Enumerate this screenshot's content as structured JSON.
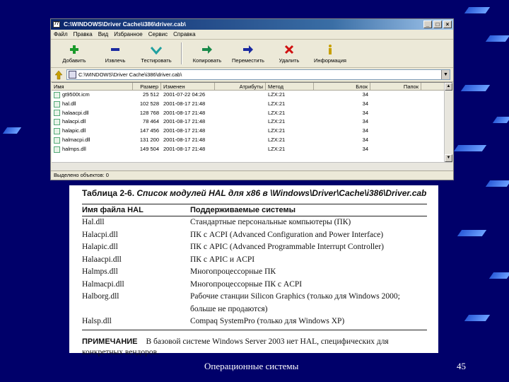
{
  "window": {
    "title": "C:\\WINDOWS\\Driver Cache\\i386\\driver.cab\\",
    "app_icon": "77",
    "menu": [
      "Файл",
      "Правка",
      "Вид",
      "Избранное",
      "Сервис",
      "Справка"
    ],
    "toolbar": [
      {
        "label": "Добавить",
        "icon": "plus-icon",
        "color": "#1a9a2a"
      },
      {
        "label": "Извлечь",
        "icon": "minus-icon",
        "color": "#1a2aa0"
      },
      {
        "label": "Тестировать",
        "icon": "check-icon",
        "color": "#20a0a0"
      },
      {
        "label": "Копировать",
        "icon": "copy-arrow-icon",
        "color": "#1a8a4a"
      },
      {
        "label": "Переместить",
        "icon": "move-arrow-icon",
        "color": "#1a2aa0"
      },
      {
        "label": "Удалить",
        "icon": "delete-x-icon",
        "color": "#d01010"
      },
      {
        "label": "Информация",
        "icon": "info-icon",
        "color": "#c8a000"
      }
    ],
    "address": "C:\\WINDOWS\\Driver Cache\\i386\\driver.cab\\",
    "columns": [
      "Имя",
      "Размер",
      "Изменен",
      "Атрибуты",
      "Метод",
      "Блок",
      "Папок"
    ],
    "files": [
      {
        "name": "gt9500t.icm",
        "size": "25 512",
        "modified": "2001-07-22 04:26",
        "method": "LZX:21",
        "block": "34"
      },
      {
        "name": "hal.dll",
        "size": "102 528",
        "modified": "2001-08-17 21:48",
        "method": "LZX:21",
        "block": "34"
      },
      {
        "name": "halaacpi.dll",
        "size": "128 768",
        "modified": "2001-08-17 21:48",
        "method": "LZX:21",
        "block": "34"
      },
      {
        "name": "halacpi.dll",
        "size": "78 464",
        "modified": "2001-08-17 21:48",
        "method": "LZX:21",
        "block": "34"
      },
      {
        "name": "halapic.dll",
        "size": "147 456",
        "modified": "2001-08-17 21:48",
        "method": "LZX:21",
        "block": "34"
      },
      {
        "name": "halmacpi.dll",
        "size": "131 200",
        "modified": "2001-08-17 21:48",
        "method": "LZX:21",
        "block": "34"
      },
      {
        "name": "halmps.dll",
        "size": "149 504",
        "modified": "2001-08-17 21:48",
        "method": "LZX:21",
        "block": "34"
      }
    ],
    "status": "Выделено объектов: 0"
  },
  "book": {
    "caption_prefix": "Таблица 2-6.",
    "caption_text": "Список модулей HAL для x86 в \\Windows\\Driver\\Cache\\i386\\Driver.cab",
    "col1": "Имя файла HAL",
    "col2": "Поддерживаемые системы",
    "rows": [
      {
        "name": "Hal.dll",
        "systems": "Стандартные персональные компьютеры (ПК)"
      },
      {
        "name": "Halacpi.dll",
        "systems": "ПК с ACPI (Advanced Configuration and Power Interface)"
      },
      {
        "name": "Halapic.dll",
        "systems": "ПК с APIC (Advanced Programmable Interrupt Controller)"
      },
      {
        "name": "Halaacpi.dll",
        "systems": "ПК с APIC и ACPI"
      },
      {
        "name": "Halmps.dll",
        "systems": "Многопроцессорные ПК"
      },
      {
        "name": "Halmacpi.dll",
        "systems": "Многопроцессорные ПК с ACPI"
      },
      {
        "name": "Halborg.dll",
        "systems": "Рабочие станции Silicon Graphics (только для Windows 2000; больше не продаются)"
      },
      {
        "name": "Halsp.dll",
        "systems": "Compaq SystemPro (только для Windows XP)"
      }
    ],
    "note_label": "ПРИМЕЧАНИЕ",
    "note_text": "В базовой системе Windows Server 2003 нет HAL, специфических для конкретных вендоров."
  },
  "footer": {
    "title": "Операционные системы",
    "page": "45"
  }
}
